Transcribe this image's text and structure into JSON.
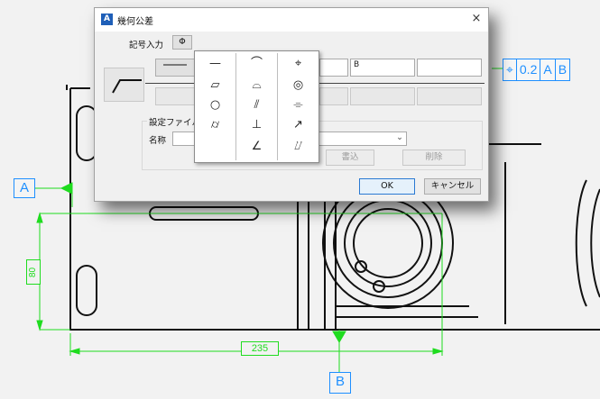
{
  "dialog": {
    "title": "幾何公差",
    "close_glyph": "×",
    "symbol_input_label": "記号入力",
    "symbol_button": "Φ",
    "datum_field_value": "B",
    "settings_file_label": "設定ファイル",
    "name_label": "名称",
    "write_button": "書込",
    "delete_button": "削除",
    "ok_button": "OK",
    "cancel_button": "キャンセル"
  },
  "symbol_palette": {
    "columns": [
      [
        "—",
        "▱",
        "○",
        "⌭"
      ],
      [
        "⌒",
        "⌓",
        "⫽",
        "⊥",
        "∠"
      ],
      [
        "⌖",
        "◎",
        "⌯",
        "↗",
        "⌰"
      ]
    ]
  },
  "drawing": {
    "feature_control_frame": [
      "⌖",
      "0.2",
      "A",
      "B"
    ],
    "datum_a": "A",
    "datum_b": "B",
    "dim_vertical": "80",
    "dim_horizontal": "235"
  },
  "colors": {
    "dimension": "#1fdc1f",
    "annotation": "#1e8fff",
    "linework": "#111111"
  }
}
